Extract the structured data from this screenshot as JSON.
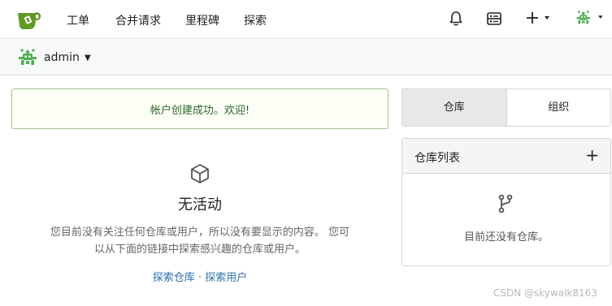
{
  "nav": {
    "items": [
      "工单",
      "合并请求",
      "里程碑",
      "探索"
    ],
    "icons": [
      "bell-icon",
      "notebook-icon",
      "plus-icon",
      "avatar"
    ]
  },
  "user": {
    "name": "admin"
  },
  "flash": {
    "message": "帐户创建成功。欢迎!"
  },
  "feed": {
    "empty_title": "无活动",
    "empty_desc_line1": "您目前没有关注任何仓库或用户，所以没有要显示的内容。 您可",
    "empty_desc_line2": "以从下面的链接中探索感兴趣的仓库或用户。",
    "explore_repos": "探索仓库",
    "separator": "·",
    "explore_users": "探索用户"
  },
  "tabs": {
    "repos": "仓库",
    "orgs": "组织"
  },
  "repo_panel": {
    "title": "仓库列表",
    "add": "+",
    "empty": "目前还没有仓库。"
  },
  "watermark": "CSDN @skywalk8163",
  "colors": {
    "accent": "#609926",
    "link": "#2d6fad",
    "flash_bg": "#fcfff5",
    "flash_text": "#2c662d"
  }
}
